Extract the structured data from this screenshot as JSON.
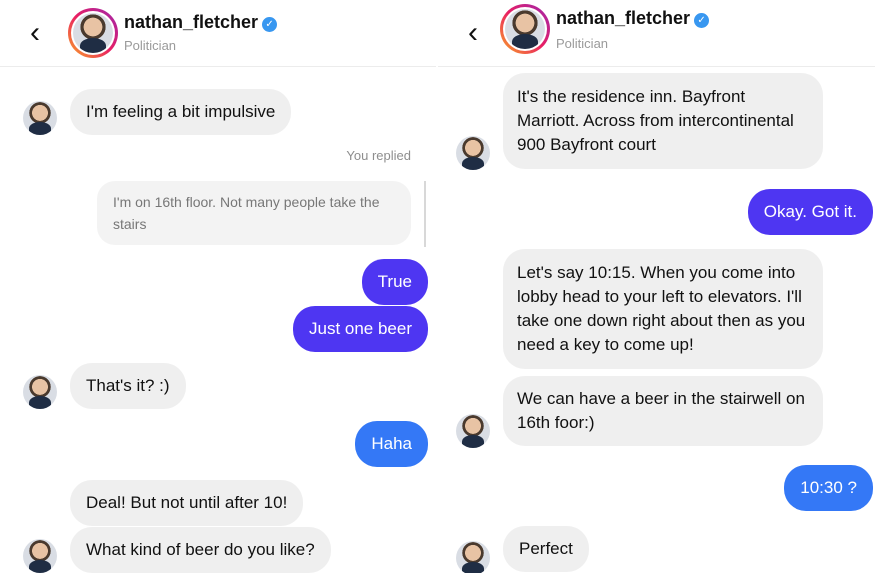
{
  "left": {
    "header": {
      "back_icon": "‹",
      "name": "nathan_fletcher",
      "subtitle": "Politician"
    },
    "messages": {
      "m1": "I'm feeling a bit impulsive",
      "replied_label": "You replied",
      "replied_quote": "I'm on 16th floor. Not many people take the stairs",
      "m2": "True",
      "m3": "Just one beer",
      "m4": "That's it? :)",
      "m5": "Haha",
      "m6": "Deal! But not until after 10!",
      "m7": "What kind of beer do you like?"
    }
  },
  "right": {
    "header": {
      "back_icon": "‹",
      "name": "nathan_fletcher",
      "subtitle": "Politician"
    },
    "messages": {
      "m1": "It's the residence inn. Bayfront Marriott. Across from intercontinental 900 Bayfront court",
      "m2": "Okay. Got it.",
      "m3": "Let's say 10:15. When you come into lobby head to your left to elevators. I'll take one down right about then as you need a key to come up!",
      "m4": "We can have a beer in the stairwell on 16th foor:)",
      "m5": "10:30 ?",
      "m6": "Perfect"
    }
  },
  "colors": {
    "outgoing_purple": "#4e36f2",
    "outgoing_blue": "#3478f6",
    "incoming_gray": "#efefef",
    "verified_blue": "#3897f0"
  }
}
